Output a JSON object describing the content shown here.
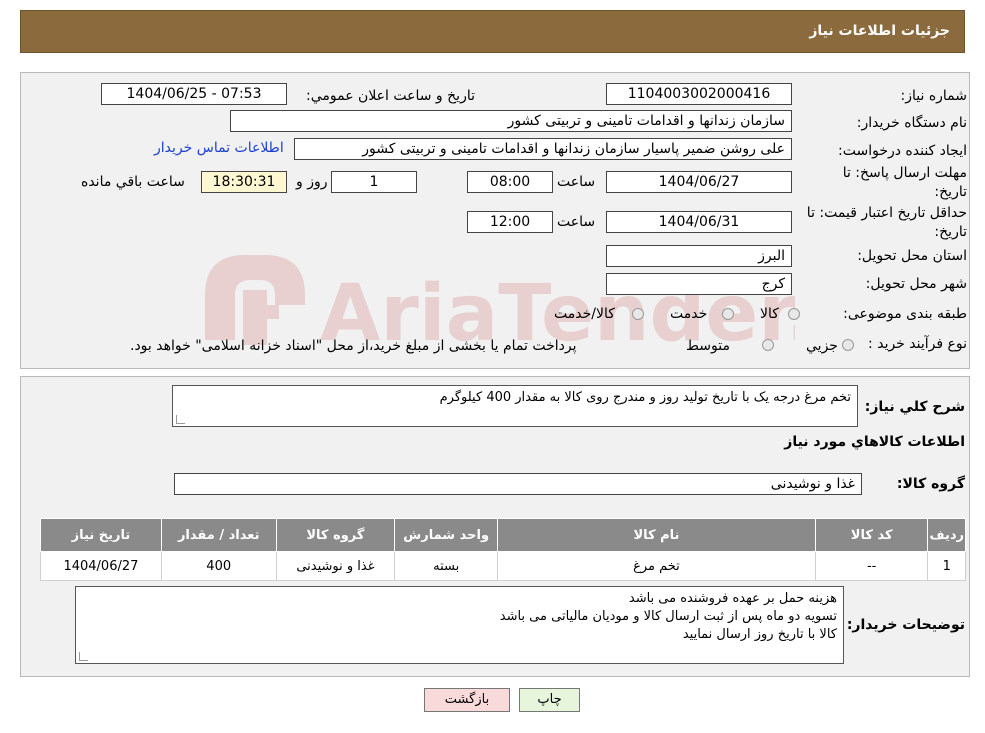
{
  "header": {
    "title": "جزئیات اطلاعات نیاز"
  },
  "fields": {
    "need_number_label": "شماره نیاز:",
    "need_number": "1104003002000416",
    "announce_label": "تاریخ و ساعت اعلان عمومي:",
    "announce_value": "1404/06/25 - 07:53",
    "buyer_org_label": "نام دستگاه خريدار:",
    "buyer_org": "سازمان زندانها و اقدامات تامینی و تربیتی کشور",
    "creator_label": "ايجاد کننده درخواست:",
    "creator": "علی روشن ضمیر پاسیار سازمان زندانها و اقدامات تامینی و تربیتی کشور",
    "contact_link": "اطلاعات تماس خريدار",
    "deadline_label": "مهلت ارسال پاسخ: تا تاريخ:",
    "deadline_date": "1404/06/27",
    "time_label": "ساعت",
    "deadline_time": "08:00",
    "days_value": "1",
    "days_label": "روز و",
    "remaining_time": "18:30:31",
    "remaining_label": "ساعت باقي مانده",
    "price_validity_label": "حداقل تاريخ اعتبار قيمت: تا تاريخ:",
    "price_validity_date": "1404/06/31",
    "price_validity_time": "12:00",
    "province_label": "استان محل تحويل:",
    "province": "البرز",
    "city_label": "شهر محل تحويل:",
    "city": "کرج",
    "category_label": "طبقه بندی موضوعی:",
    "category_options": [
      "کالا",
      "خدمت",
      "کالا/خدمت"
    ],
    "process_label": "نوع فرآيند خريد :",
    "process_options": [
      "جزيي",
      "متوسط"
    ],
    "process_note": "پرداخت تمام یا بخشی از مبلغ خرید،از محل \"اسناد خزانه اسلامی\" خواهد بود."
  },
  "description": {
    "label": "شرح کلي نياز:",
    "text": "تخم مرغ درجه یک با تاریخ تولید روز و مندرج روی کالا به مقدار 400 کیلوگرم",
    "goods_info_title": "اطلاعات کالاهاي مورد نياز",
    "goods_group_label": "گروه کالا:",
    "goods_group": "غذا و نوشیدنی"
  },
  "table": {
    "headers": [
      "رديف",
      "کد کالا",
      "نام کالا",
      "واحد شمارش",
      "گروه کالا",
      "تعداد / مقدار",
      "تاريخ نياز"
    ],
    "rows": [
      [
        "1",
        "--",
        "تخم مرغ",
        "بسته",
        "غذا و نوشیدنی",
        "400",
        "1404/06/27"
      ]
    ]
  },
  "buyer_notes": {
    "label": "توضيحات خريدار:",
    "lines": [
      "هزینه حمل بر عهده فروشنده می باشد",
      "تسویه دو ماه پس از ثبت ارسال کالا و مودیان مالیاتی می باشد",
      "کالا با تاریخ روز ارسال نمایید"
    ]
  },
  "buttons": {
    "print": "چاپ",
    "back": "بازگشت"
  },
  "watermark": {
    "text": "AriaTender.neT"
  },
  "colors": {
    "header": "#8b6b3d",
    "panel": "#f1f1f1",
    "remaining": "#fdf7d2",
    "back_button": "#f8dada",
    "print_button": "#e6f5dc",
    "table_header": "#8a8a8a",
    "link": "#1a3fd6"
  }
}
